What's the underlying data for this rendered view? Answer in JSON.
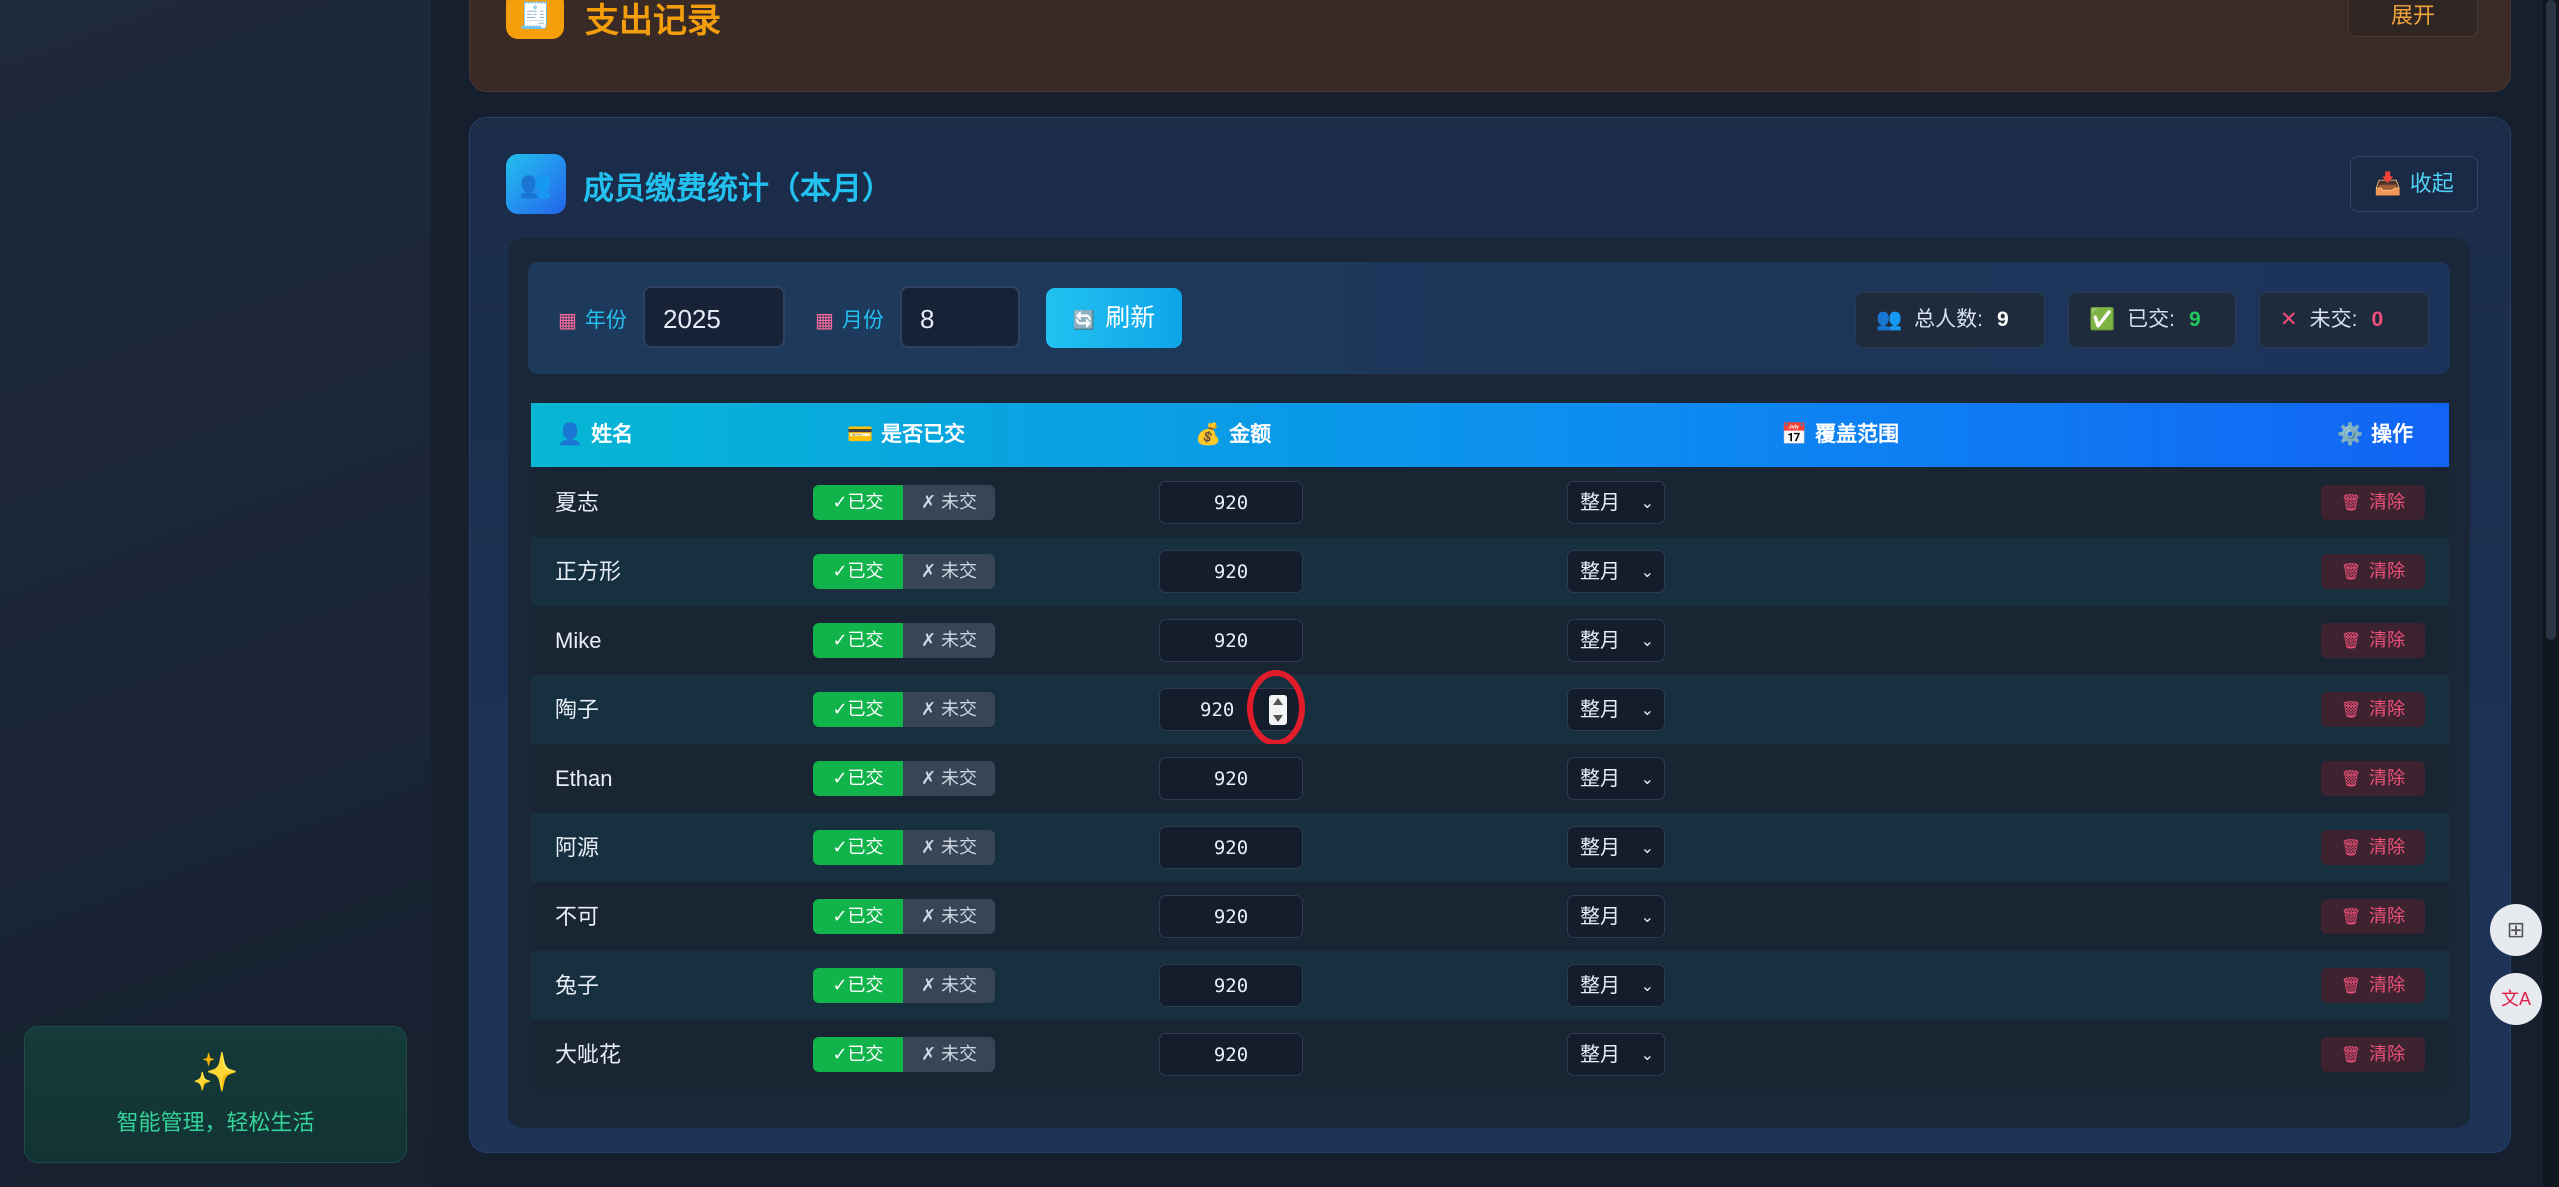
{
  "sidebar": {
    "tagline_icon": "sparkles-icon",
    "tagline": "智能管理，轻松生活"
  },
  "expense_card": {
    "title": "支出记录",
    "toggle": "展开"
  },
  "stats_card": {
    "title": "成员缴费统计（本月）",
    "collapse": "收起",
    "filters": {
      "year_label": "年份",
      "year_value": "2025",
      "month_label": "月份",
      "month_value": "8",
      "refresh": "刷新"
    },
    "summary": {
      "total_label": "总人数:",
      "total": "9",
      "paid_label": "已交:",
      "paid": "9",
      "unpaid_label": "未交:",
      "unpaid": "0"
    },
    "columns": [
      "姓名",
      "是否已交",
      "金额",
      "覆盖范围",
      "操作"
    ],
    "toggle_paid": "✓已交",
    "toggle_unpaid": "✗ 未交",
    "clear_label": "清除",
    "rows": [
      {
        "name": "夏志",
        "amount": "920",
        "range": "整月"
      },
      {
        "name": "正方形",
        "amount": "920",
        "range": "整月"
      },
      {
        "name": "Mike",
        "amount": "920",
        "range": "整月"
      },
      {
        "name": "陶子",
        "amount": "920",
        "range": "整月"
      },
      {
        "name": "Ethan",
        "amount": "920",
        "range": "整月"
      },
      {
        "name": "阿源",
        "amount": "920",
        "range": "整月"
      },
      {
        "name": "不可",
        "amount": "920",
        "range": "整月"
      },
      {
        "name": "兔子",
        "amount": "920",
        "range": "整月"
      },
      {
        "name": "大呲花",
        "amount": "920",
        "range": "整月"
      }
    ]
  },
  "colors": {
    "accent": "#22c1f0",
    "paid_green": "#10b44a",
    "danger": "#f0507a",
    "highlight_circle": "#e11d2a"
  }
}
